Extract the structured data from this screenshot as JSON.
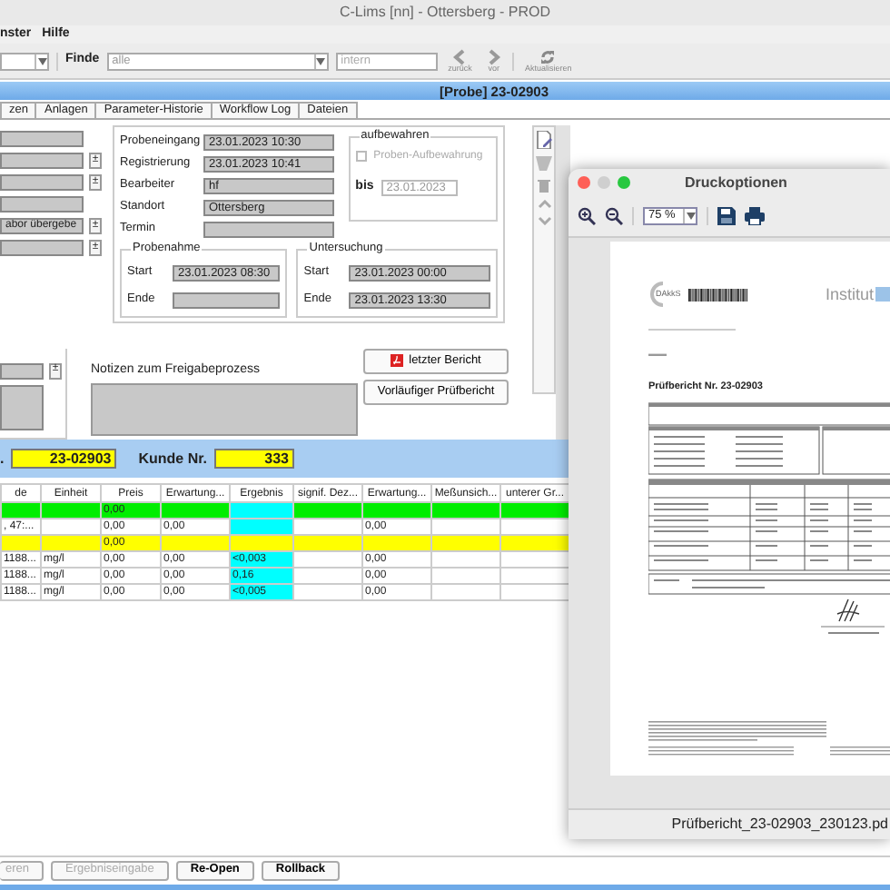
{
  "window": {
    "title": "C-Lims [nn] - Ottersberg - PROD"
  },
  "menu": [
    "nster",
    "Hilfe"
  ],
  "toolbar": {
    "find_label": "Finde",
    "find_value": "alle",
    "filter_placeholder": "intern",
    "buttons": [
      {
        "kind": "back",
        "label": "zurück"
      },
      {
        "kind": "forward",
        "label": "vor"
      },
      {
        "kind": "refresh",
        "label": "Aktualisieren"
      }
    ]
  },
  "header": {
    "title": "[Probe] 23-02903"
  },
  "tabs": [
    "zen",
    "Anlagen",
    "Parameter-Historie",
    "Workflow Log",
    "Dateien"
  ],
  "left_fields": [
    {
      "kind": "plain"
    },
    {
      "kind": "spin",
      "spinner": "±"
    },
    {
      "kind": "spin",
      "spinner": "±"
    },
    {
      "kind": "plain"
    },
    {
      "kind": "spin",
      "value": "abor übergebe",
      "spinner": "±"
    },
    {
      "kind": "spin",
      "spinner": "±"
    }
  ],
  "side_panel": {
    "spinner": "±"
  },
  "details": [
    {
      "label": "Probeneingang",
      "value": "23.01.2023 10:30"
    },
    {
      "label": "Registrierung",
      "value": "23.01.2023 10:41"
    },
    {
      "label": "Bearbeiter",
      "value": "hf"
    },
    {
      "label": "Standort",
      "value": "Ottersberg"
    },
    {
      "label": "Termin"
    }
  ],
  "aufbewahren": {
    "title": "aufbewahren",
    "checkbox_label": "Proben-Aufbewahrung",
    "checked": false,
    "disabled": true,
    "until_label": "bis",
    "until": "23.01.2023"
  },
  "periods": [
    {
      "title": "Probenahme",
      "start_label": "Start",
      "start": "23.01.2023 08:30",
      "end_label": "Ende"
    },
    {
      "title": "Untersuchung",
      "start_label": "Start",
      "start": "23.01.2023 00:00",
      "end_label": "Ende",
      "end": "23.01.2023 13:30"
    }
  ],
  "notes": {
    "label": "Notizen zum Freigabeprozess"
  },
  "report_buttons": [
    {
      "kind": "pdf",
      "label": "letzter Bericht"
    },
    {
      "kind": "plain",
      "label": "Vorläufiger Prüfbericht"
    }
  ],
  "summary": {
    "sample_label": ".",
    "sample_no": "23-02903",
    "customer_label": "Kunde Nr.",
    "customer_no": "333"
  },
  "table": {
    "columns": [
      "de",
      "Einheit",
      "Preis",
      "Erwartung...",
      "Ergebnis",
      "signif. Dez...",
      "Erwartung...",
      "Meßunsich...",
      "unterer Gr..."
    ],
    "rows": [
      {
        "color": "#00ee00",
        "result_highlight": true,
        "cells": [
          null,
          null,
          "0,00",
          null,
          null,
          null,
          null,
          null,
          null
        ]
      },
      {
        "color": "#ffffff",
        "result_highlight": true,
        "cells": [
          ", 47:...",
          null,
          "0,00",
          "0,00",
          null,
          null,
          "0,00",
          null,
          null
        ]
      },
      {
        "color": "#ffff00",
        "result_highlight": false,
        "cells": [
          null,
          null,
          "0,00",
          null,
          null,
          null,
          null,
          null,
          null
        ]
      },
      {
        "color": "#ffffff",
        "result_highlight": true,
        "cells": [
          "1188...",
          "mg/l",
          "0,00",
          "0,00",
          "<0,003",
          null,
          "0,00",
          null,
          null
        ]
      },
      {
        "color": "#ffffff",
        "result_highlight": true,
        "cells": [
          "1188...",
          "mg/l",
          "0,00",
          "0,00",
          "0,16",
          null,
          "0,00",
          null,
          null
        ]
      },
      {
        "color": "#ffffff",
        "result_highlight": true,
        "cells": [
          "1188...",
          "mg/l",
          "0,00",
          "0,00",
          "<0,005",
          null,
          "0,00",
          null,
          null
        ]
      }
    ]
  },
  "bottom_buttons": [
    {
      "label": "eren",
      "disabled": true
    },
    {
      "label": "Ergebniseingabe",
      "disabled": true
    },
    {
      "label": "Re-Open",
      "disabled": false
    },
    {
      "label": "Rollback",
      "disabled": false
    }
  ],
  "dialog": {
    "title": "Druckoptionen",
    "zoom": "75 %",
    "document": {
      "logo": "DAkkS",
      "institute": "Institut",
      "heading": "Prüfbericht Nr. 23-02903"
    },
    "filename": "Prüfbericht_23-02903_230123.pd"
  }
}
